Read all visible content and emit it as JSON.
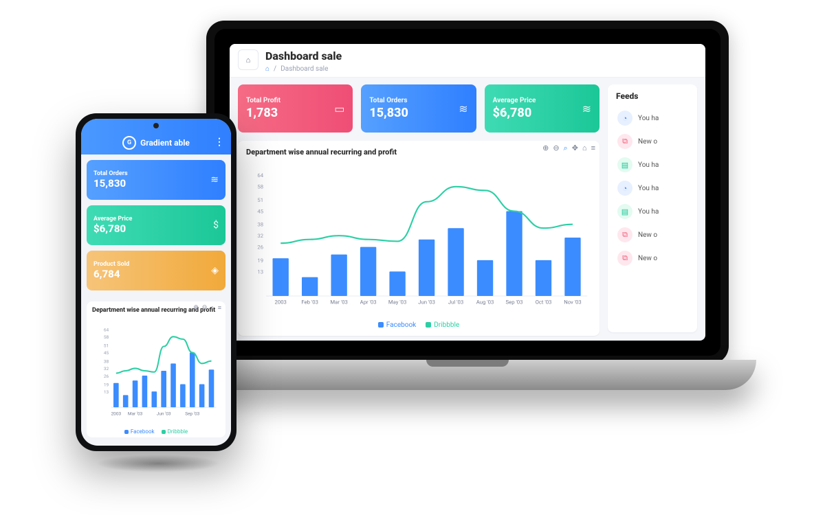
{
  "brand": {
    "name": "Gradient able",
    "logo_glyph": "G"
  },
  "laptop": {
    "page_title": "Dashboard sale",
    "breadcrumb": {
      "home_glyph": "⌂",
      "sep": "/",
      "page": "Dashboard sale"
    },
    "kpis": [
      {
        "label": "Total Profit",
        "value": "1,783",
        "icon": "cash-icon",
        "color": "red"
      },
      {
        "label": "Total Orders",
        "value": "15,830",
        "icon": "database-icon",
        "color": "blue"
      },
      {
        "label": "Average Price",
        "value": "$6,780",
        "icon": "database-icon",
        "color": "green"
      }
    ],
    "chart_panel": {
      "title": "Department wise annual recurring and profit",
      "toolbar": [
        "plus-icon",
        "minus-icon",
        "zoom-icon",
        "hand-icon",
        "home-icon",
        "menu-icon"
      ]
    },
    "feeds": {
      "title": "Feeds",
      "items": [
        {
          "icon": "bell-icon",
          "color": "blue",
          "text": "You ha"
        },
        {
          "icon": "cart-icon",
          "color": "pink",
          "text": "New o"
        },
        {
          "icon": "file-icon",
          "color": "green",
          "text": "You ha"
        },
        {
          "icon": "bell-icon",
          "color": "blue",
          "text": "You ha"
        },
        {
          "icon": "file-icon",
          "color": "green",
          "text": "You ha"
        },
        {
          "icon": "cart-icon",
          "color": "pink",
          "text": "New o"
        },
        {
          "icon": "cart-icon",
          "color": "pink",
          "text": "New o"
        }
      ]
    }
  },
  "phone": {
    "cards": [
      {
        "label": "Total Orders",
        "value": "15,830",
        "icon": "database-icon",
        "color": "blue"
      },
      {
        "label": "Average Price",
        "value": "$6,780",
        "icon": "dollar-icon",
        "color": "green"
      },
      {
        "label": "Product Sold",
        "value": "6,784",
        "icon": "tag-icon",
        "color": "orange"
      }
    ],
    "chart_panel": {
      "title": "Department wise annual recurring and profit",
      "toolbar": [
        "plus-icon",
        "minus-icon",
        "home-icon",
        "menu-icon"
      ]
    }
  },
  "chart_data": {
    "type": "bar",
    "title": "Department wise annual recurring and profit",
    "xlabel": "",
    "ylabel": "",
    "ylim": [
      0,
      64
    ],
    "y_ticks": [
      13,
      19,
      26,
      32,
      38,
      45,
      51,
      58,
      64
    ],
    "categories": [
      "2003",
      "Feb '03",
      "Mar '03",
      "Apr '03",
      "May '03",
      "Jun '03",
      "Jul '03",
      "Aug '03",
      "Sep '03",
      "Oct '03",
      "Nov '03"
    ],
    "series": [
      {
        "name": "Facebook",
        "type": "bar",
        "color": "#3b8cff",
        "values": [
          20,
          10,
          22,
          26,
          13,
          30,
          36,
          19,
          45,
          19,
          31
        ]
      },
      {
        "name": "Dribbble",
        "type": "line",
        "color": "#2ccfa4",
        "values": [
          28,
          30,
          32,
          30,
          29,
          50,
          58,
          56,
          45,
          36,
          38
        ]
      }
    ],
    "phone_categories": [
      "2003",
      "Mar '03",
      "Jun '03",
      "Sep '03"
    ]
  },
  "legend": {
    "fb": "Facebook",
    "dr": "Dribbble"
  },
  "icons": {
    "cash-icon": "▭",
    "database-icon": "≋",
    "dollar-icon": "$",
    "tag-icon": "◈",
    "bell-icon": "◔",
    "cart-icon": "⧉",
    "file-icon": "▤",
    "plus-icon": "⊕",
    "minus-icon": "⊖",
    "zoom-icon": "⌕",
    "hand-icon": "✥",
    "home-icon": "⌂",
    "menu-icon": "≡"
  }
}
